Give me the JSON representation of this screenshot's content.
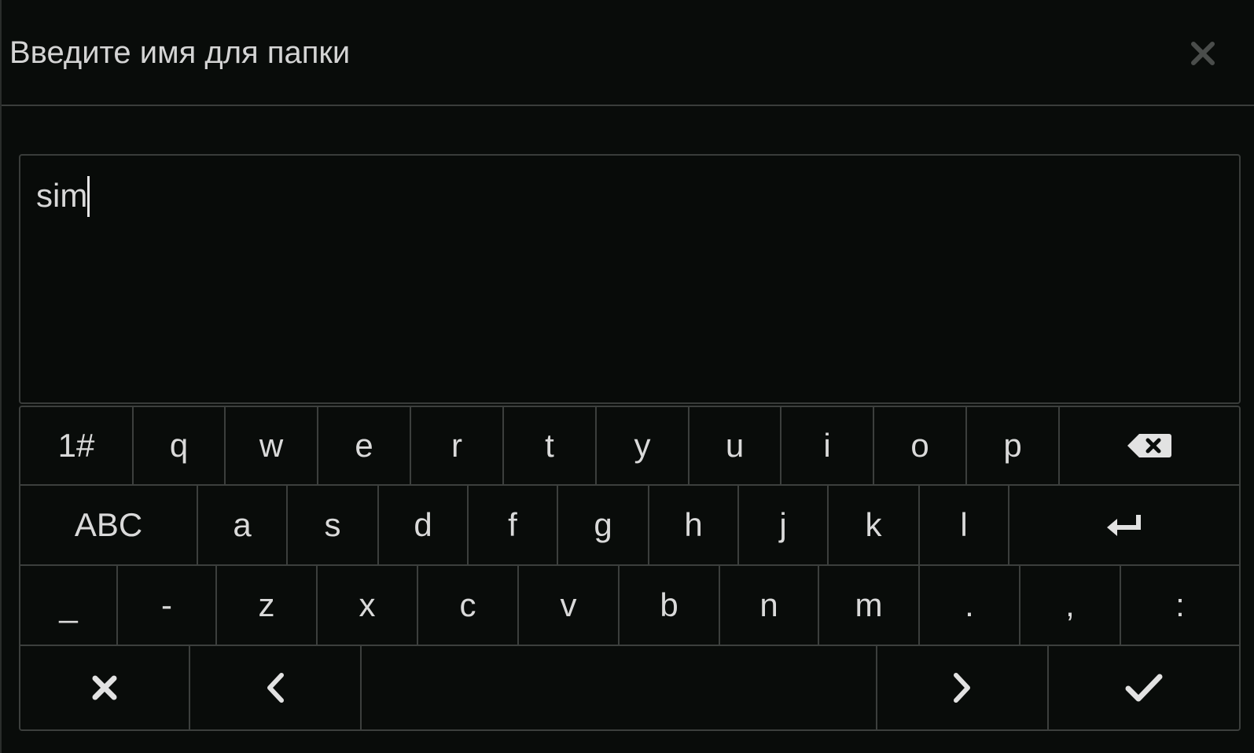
{
  "dialog": {
    "title": "Введите имя для папки",
    "close_icon": "close-icon"
  },
  "input": {
    "value": "sim"
  },
  "keyboard": {
    "row1": [
      {
        "label": "1#",
        "name": "key-symbols"
      },
      {
        "label": "q",
        "name": "key-q"
      },
      {
        "label": "w",
        "name": "key-w"
      },
      {
        "label": "e",
        "name": "key-e"
      },
      {
        "label": "r",
        "name": "key-r"
      },
      {
        "label": "t",
        "name": "key-t"
      },
      {
        "label": "y",
        "name": "key-y"
      },
      {
        "label": "u",
        "name": "key-u"
      },
      {
        "label": "i",
        "name": "key-i"
      },
      {
        "label": "o",
        "name": "key-o"
      },
      {
        "label": "p",
        "name": "key-p"
      }
    ],
    "row1_icon": "backspace-icon",
    "row2": [
      {
        "label": "ABC",
        "name": "key-shift-abc"
      },
      {
        "label": "a",
        "name": "key-a"
      },
      {
        "label": "s",
        "name": "key-s"
      },
      {
        "label": "d",
        "name": "key-d"
      },
      {
        "label": "f",
        "name": "key-f"
      },
      {
        "label": "g",
        "name": "key-g"
      },
      {
        "label": "h",
        "name": "key-h"
      },
      {
        "label": "j",
        "name": "key-j"
      },
      {
        "label": "k",
        "name": "key-k"
      },
      {
        "label": "l",
        "name": "key-l"
      }
    ],
    "row2_icon": "enter-icon",
    "row3": [
      {
        "label": "_",
        "name": "key-underscore"
      },
      {
        "label": "-",
        "name": "key-hyphen"
      },
      {
        "label": "z",
        "name": "key-z"
      },
      {
        "label": "x",
        "name": "key-x"
      },
      {
        "label": "c",
        "name": "key-c"
      },
      {
        "label": "v",
        "name": "key-v"
      },
      {
        "label": "b",
        "name": "key-b"
      },
      {
        "label": "n",
        "name": "key-n"
      },
      {
        "label": "m",
        "name": "key-m"
      },
      {
        "label": ".",
        "name": "key-period"
      },
      {
        "label": ",",
        "name": "key-comma"
      },
      {
        "label": ":",
        "name": "key-colon"
      }
    ],
    "row4_icons": [
      "cancel-icon",
      "arrow-left-icon",
      "space-key",
      "arrow-right-icon",
      "confirm-check-icon"
    ]
  }
}
